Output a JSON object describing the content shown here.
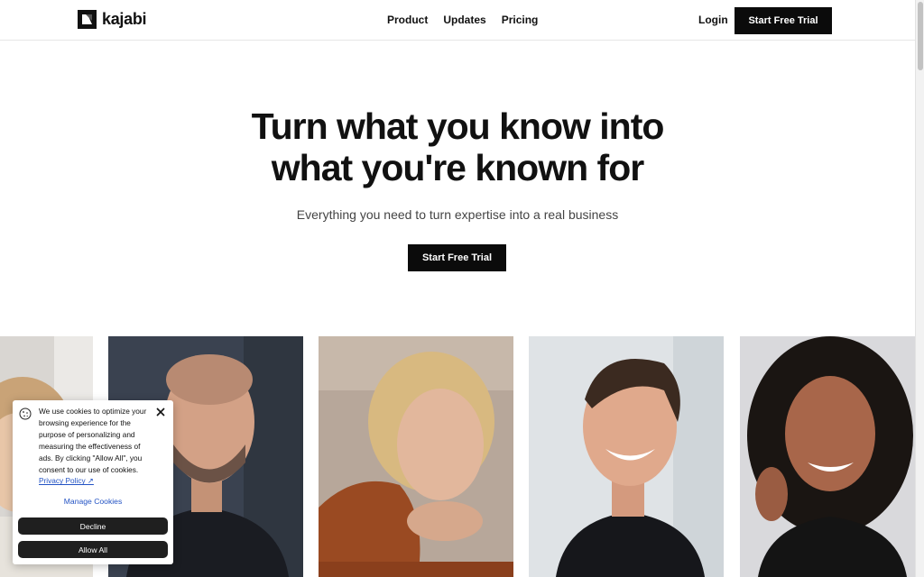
{
  "header": {
    "logo_text": "kajabi",
    "nav": [
      {
        "label": "Product"
      },
      {
        "label": "Updates"
      },
      {
        "label": "Pricing"
      }
    ],
    "login_label": "Login",
    "cta_label": "Start Free Trial"
  },
  "hero": {
    "title_line1": "Turn what you know into",
    "title_line2": "what you're known for",
    "subtitle": "Everything you need to turn expertise into a real business",
    "cta_label": "Start Free Trial"
  },
  "cookie_banner": {
    "message": "We use cookies to optimize your browsing experience for the purpose of personalizing and measuring the effectiveness of ads. By clicking \"Allow All\", you consent to our use of cookies.",
    "privacy_link": "Privacy Policy ↗",
    "manage_label": "Manage Cookies",
    "decline_label": "Decline",
    "allow_label": "Allow All"
  },
  "icons": {
    "cookie": "cookie-icon",
    "close": "close-icon"
  },
  "colors": {
    "primary_button": "#0b0b0b",
    "link": "#2353c4",
    "text": "#111111"
  }
}
